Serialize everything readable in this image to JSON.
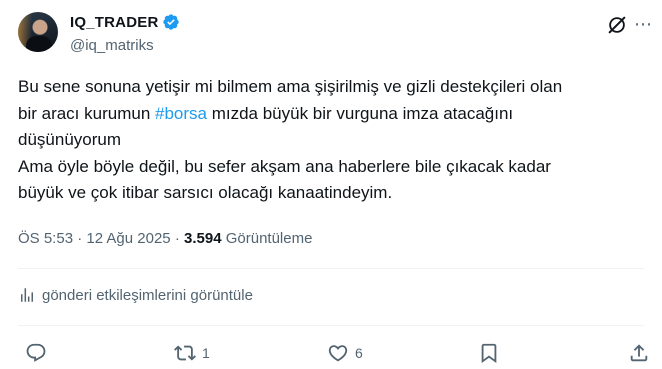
{
  "author": {
    "display_name": "IQ_TRADER",
    "handle": "@iq_matriks",
    "verified": true,
    "verified_color": "#1d9bf0"
  },
  "post": {
    "lines": [
      [
        "Bu sene sonuna yetişir mi bilmem ama şişirilmiş ve gizli destekçileri olan"
      ],
      [
        "bir aracı kurumun ",
        "#borsa",
        " mızda büyük bir vurguna imza atacağını"
      ],
      [
        "düşünüyorum"
      ],
      [
        "Ama öyle böyle değil, bu sefer akşam ana haberlere bile çıkacak kadar"
      ],
      [
        "büyük ve çok itibar sarsıcı olacağı kanaatindeyim."
      ]
    ],
    "hashtag_color": "#1d9bf0"
  },
  "meta": {
    "time": "ÖS 5:53",
    "separator": " · ",
    "date": "12 Ağu 2025",
    "views_count": "3.594",
    "views_label": "Görüntüleme"
  },
  "engagement": {
    "label": "gönderi etkileşimlerini görüntüle",
    "icon": "analytics-icon"
  },
  "actions": {
    "reply_count": "",
    "repost_count": "1",
    "like_count": "6"
  },
  "icons": [
    "verified-badge-icon",
    "grok-icon",
    "more-icon",
    "reply-icon",
    "repost-icon",
    "like-icon",
    "bookmark-icon",
    "share-icon"
  ]
}
